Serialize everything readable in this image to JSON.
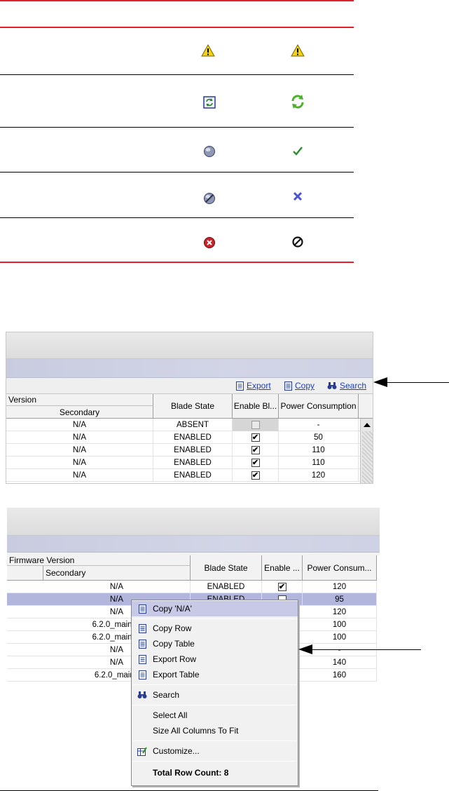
{
  "icon_table": {
    "rows": [
      {
        "col1_icon": "warning-triangle-icon",
        "col2_icon": "warning-triangle-icon"
      },
      {
        "col1_icon": "refresh-box-icon",
        "col2_icon": "refresh-arrows-icon"
      },
      {
        "col1_icon": "grey-circle-icon",
        "col2_icon": "green-check-icon"
      },
      {
        "col1_icon": "slashed-circle-icon",
        "col2_icon": "blue-x-icon"
      },
      {
        "col1_icon": "red-x-circle-icon",
        "col2_icon": "black-no-symbol-icon"
      }
    ]
  },
  "screenshot1": {
    "toolbar": {
      "export_label": "Export",
      "copy_label": "Copy",
      "search_label": "Search"
    },
    "headers": {
      "version": "Version",
      "secondary": "Secondary",
      "blade_state": "Blade State",
      "enable": "Enable Bl...",
      "power": "Power Consumption"
    },
    "rows": [
      {
        "secondary": "N/A",
        "blade_state": "ABSENT",
        "enabled": false,
        "disabled_box": true,
        "power": "-"
      },
      {
        "secondary": "N/A",
        "blade_state": "ENABLED",
        "enabled": true,
        "disabled_box": false,
        "power": "50"
      },
      {
        "secondary": "N/A",
        "blade_state": "ENABLED",
        "enabled": true,
        "disabled_box": false,
        "power": "110"
      },
      {
        "secondary": "N/A",
        "blade_state": "ENABLED",
        "enabled": true,
        "disabled_box": false,
        "power": "110"
      },
      {
        "secondary": "N/A",
        "blade_state": "ENABLED",
        "enabled": true,
        "disabled_box": false,
        "power": "120"
      }
    ]
  },
  "screenshot2": {
    "headers": {
      "firmware_version": "Firmware Version",
      "secondary": "Secondary",
      "blade_state": "Blade State",
      "enable": "Enable ...",
      "power": "Power Consum..."
    },
    "rows": [
      {
        "secondary": "N/A",
        "blade_state": "ENABLED",
        "power": "120"
      },
      {
        "secondary": "N/A",
        "blade_state": "ENABLED",
        "power": "95"
      },
      {
        "secondary": "N/A",
        "blade_state": "",
        "power": "120"
      },
      {
        "secondary": "6.2.0_main_b",
        "blade_state": "",
        "power": "100"
      },
      {
        "secondary": "6.2.0_main_b",
        "blade_state": "",
        "power": "100"
      },
      {
        "secondary": "N/A",
        "blade_state": "",
        "power": "-"
      },
      {
        "secondary": "N/A",
        "blade_state": "",
        "power": "140"
      },
      {
        "secondary": "6.2.0_main_",
        "blade_state": "",
        "power": "160"
      }
    ],
    "context_menu": {
      "copy_value": "Copy 'N/A'",
      "copy_row": "Copy Row",
      "copy_table": "Copy Table",
      "export_row": "Export Row",
      "export_table": "Export Table",
      "search": "Search",
      "select_all": "Select All",
      "size_columns": "Size All Columns To Fit",
      "customize": "Customize...",
      "total_row_count": "Total Row Count: 8"
    }
  },
  "colors": {
    "rule_red": "#e0202a",
    "link_blue": "#1a3fb8",
    "selection": "#b3b6dc"
  }
}
